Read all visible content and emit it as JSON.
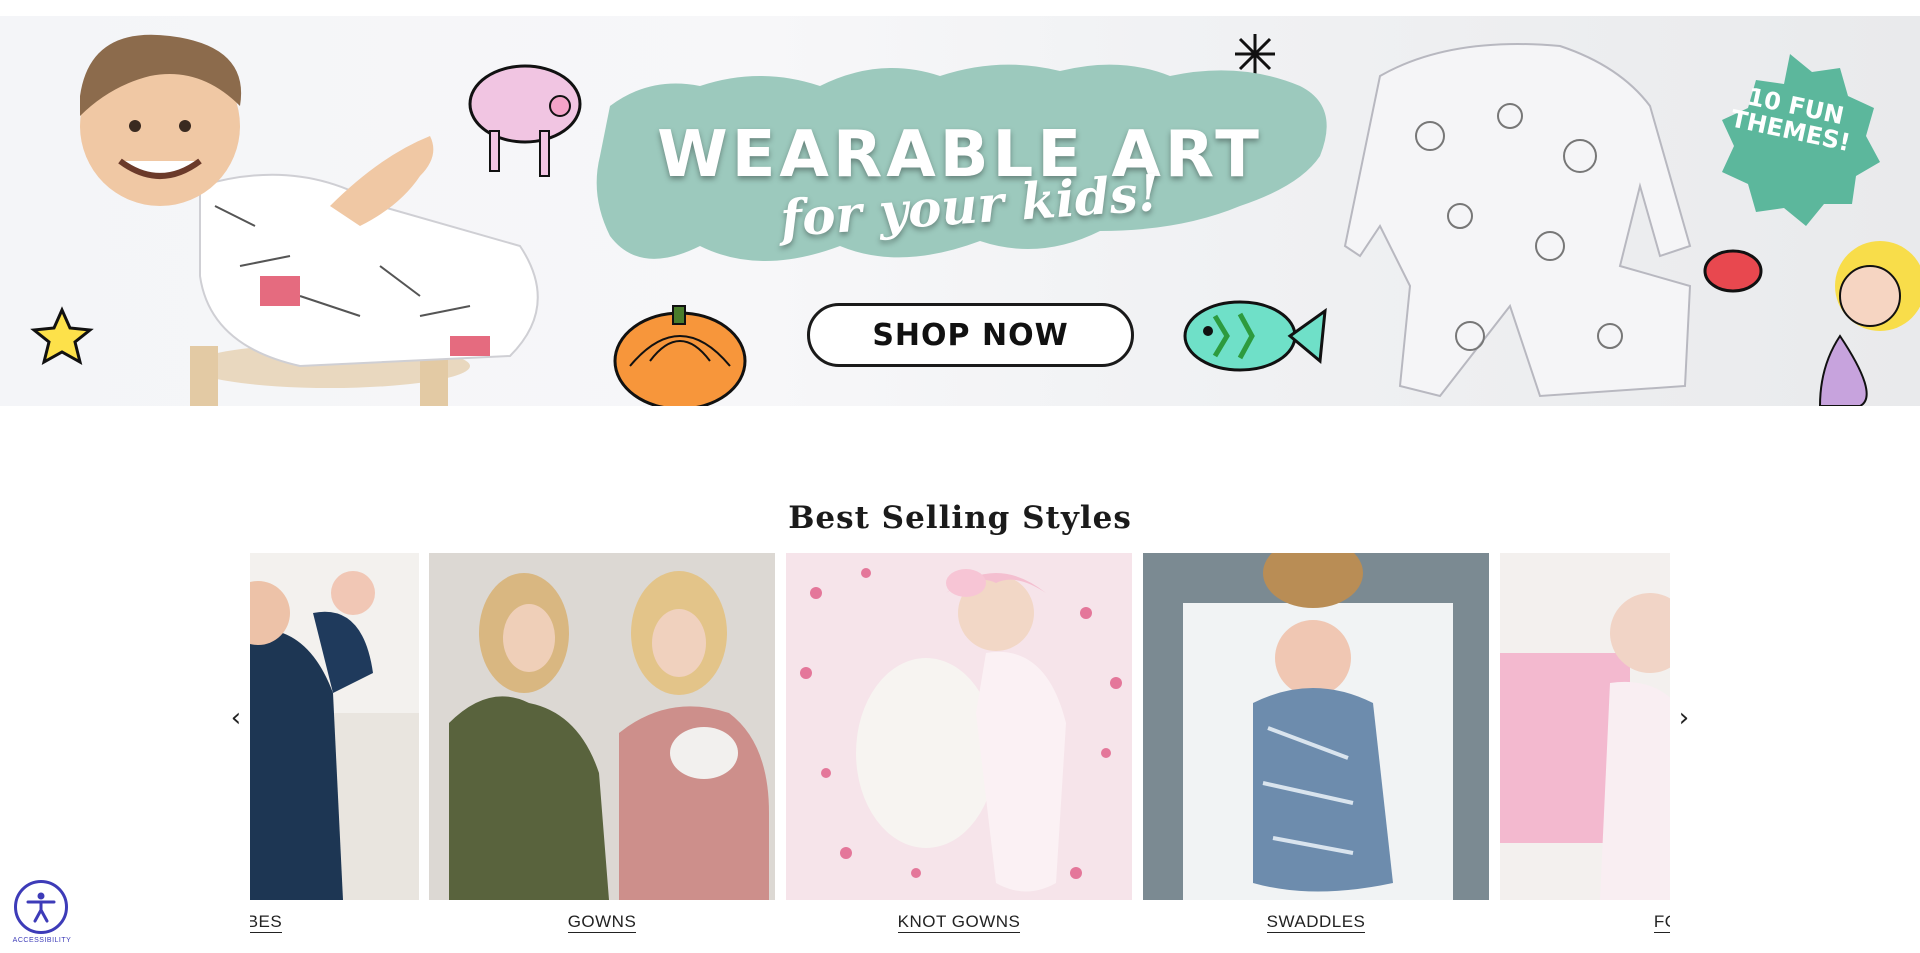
{
  "hero": {
    "title": "WEARABLE ART",
    "subtitle": "for your kids!",
    "cta_label": "SHOP NOW",
    "badge": "10 FUN THEMES!",
    "colors": {
      "blob": "#9cc9bd",
      "badge": "#5cb79c",
      "pumpkin": "#f7963b"
    }
  },
  "best_selling": {
    "title": "Best Selling Styles",
    "prev_icon": "‹",
    "next_icon": "›",
    "cards": [
      {
        "label": "ROBES",
        "shown": ". ROBES"
      },
      {
        "label": "GOWNS"
      },
      {
        "label": "KNOT GOWNS"
      },
      {
        "label": "SWADDLES"
      },
      {
        "label": "FOO"
      }
    ]
  },
  "accessibility": {
    "label": "ACCESSIBILITY"
  }
}
